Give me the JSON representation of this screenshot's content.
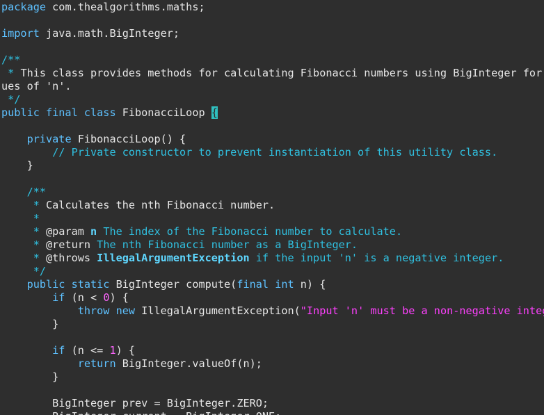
{
  "editor": {
    "colors": {
      "background": "#2e2e2e",
      "text": "#e6e6e6",
      "keyword": "#5ec1ff",
      "comment": "#30c0e0",
      "number": "#ff66ff",
      "string": "#ff40ff",
      "cursor": "#2fbfbf"
    },
    "lines": [
      [
        {
          "t": "kw",
          "v": "package"
        },
        {
          "t": "plain",
          "v": " com.thealgorithms.maths;"
        }
      ],
      [],
      [
        {
          "t": "kw",
          "v": "import"
        },
        {
          "t": "plain",
          "v": " java.math.BigInteger;"
        }
      ],
      [],
      [
        {
          "t": "cm",
          "v": "/**"
        }
      ],
      [
        {
          "t": "cm",
          "v": " * "
        },
        {
          "t": "plain",
          "v": "This class provides methods for calculating Fibonacci numbers using BigInteger for l"
        }
      ],
      [
        {
          "t": "plain",
          "v": "ues of 'n'."
        }
      ],
      [
        {
          "t": "cm",
          "v": " */"
        }
      ],
      [
        {
          "t": "kw",
          "v": "public final class"
        },
        {
          "t": "plain",
          "v": " FibonacciLoop "
        },
        {
          "t": "cursor",
          "v": "{"
        }
      ],
      [],
      [
        {
          "t": "plain",
          "v": "    "
        },
        {
          "t": "kw",
          "v": "private"
        },
        {
          "t": "plain",
          "v": " FibonacciLoop() {"
        }
      ],
      [
        {
          "t": "plain",
          "v": "        "
        },
        {
          "t": "cm",
          "v": "// Private constructor to prevent instantiation of this utility class."
        }
      ],
      [
        {
          "t": "plain",
          "v": "    }"
        }
      ],
      [],
      [
        {
          "t": "plain",
          "v": "    "
        },
        {
          "t": "cm",
          "v": "/**"
        }
      ],
      [
        {
          "t": "plain",
          "v": "     "
        },
        {
          "t": "cm",
          "v": "* "
        },
        {
          "t": "plain",
          "v": "Calculates the nth Fibonacci number."
        }
      ],
      [
        {
          "t": "plain",
          "v": "     "
        },
        {
          "t": "cm",
          "v": "*"
        }
      ],
      [
        {
          "t": "plain",
          "v": "     "
        },
        {
          "t": "cm",
          "v": "* "
        },
        {
          "t": "plain",
          "v": "@param "
        },
        {
          "t": "tag",
          "v": "n"
        },
        {
          "t": "cm",
          "v": " The index of the Fibonacci number to calculate."
        }
      ],
      [
        {
          "t": "plain",
          "v": "     "
        },
        {
          "t": "cm",
          "v": "* "
        },
        {
          "t": "plain",
          "v": "@return"
        },
        {
          "t": "cm",
          "v": " The nth Fibonacci number as a BigInteger."
        }
      ],
      [
        {
          "t": "plain",
          "v": "     "
        },
        {
          "t": "cm",
          "v": "* "
        },
        {
          "t": "plain",
          "v": "@throws "
        },
        {
          "t": "tag",
          "v": "IllegalArgumentException"
        },
        {
          "t": "cm",
          "v": " if the input 'n' is a negative integer."
        }
      ],
      [
        {
          "t": "plain",
          "v": "     "
        },
        {
          "t": "cm",
          "v": "*/"
        }
      ],
      [
        {
          "t": "plain",
          "v": "    "
        },
        {
          "t": "kw",
          "v": "public static"
        },
        {
          "t": "plain",
          "v": " BigInteger compute("
        },
        {
          "t": "kw",
          "v": "final int"
        },
        {
          "t": "plain",
          "v": " n) {"
        }
      ],
      [
        {
          "t": "plain",
          "v": "        "
        },
        {
          "t": "kw",
          "v": "if"
        },
        {
          "t": "plain",
          "v": " (n < "
        },
        {
          "t": "num",
          "v": "0"
        },
        {
          "t": "plain",
          "v": ") {"
        }
      ],
      [
        {
          "t": "plain",
          "v": "            "
        },
        {
          "t": "kw",
          "v": "throw new"
        },
        {
          "t": "plain",
          "v": " IllegalArgumentException("
        },
        {
          "t": "str",
          "v": "\"Input 'n' must be a non-negative intege"
        }
      ],
      [
        {
          "t": "plain",
          "v": "        }"
        }
      ],
      [],
      [
        {
          "t": "plain",
          "v": "        "
        },
        {
          "t": "kw",
          "v": "if"
        },
        {
          "t": "plain",
          "v": " (n <= "
        },
        {
          "t": "num",
          "v": "1"
        },
        {
          "t": "plain",
          "v": ") {"
        }
      ],
      [
        {
          "t": "plain",
          "v": "            "
        },
        {
          "t": "kw",
          "v": "return"
        },
        {
          "t": "plain",
          "v": " BigInteger.valueOf(n);"
        }
      ],
      [
        {
          "t": "plain",
          "v": "        }"
        }
      ],
      [],
      [
        {
          "t": "plain",
          "v": "        BigInteger prev = BigInteger.ZERO;"
        }
      ],
      [
        {
          "t": "plain",
          "v": "        BigInteger current = BigInteger.ONE;"
        }
      ]
    ]
  }
}
